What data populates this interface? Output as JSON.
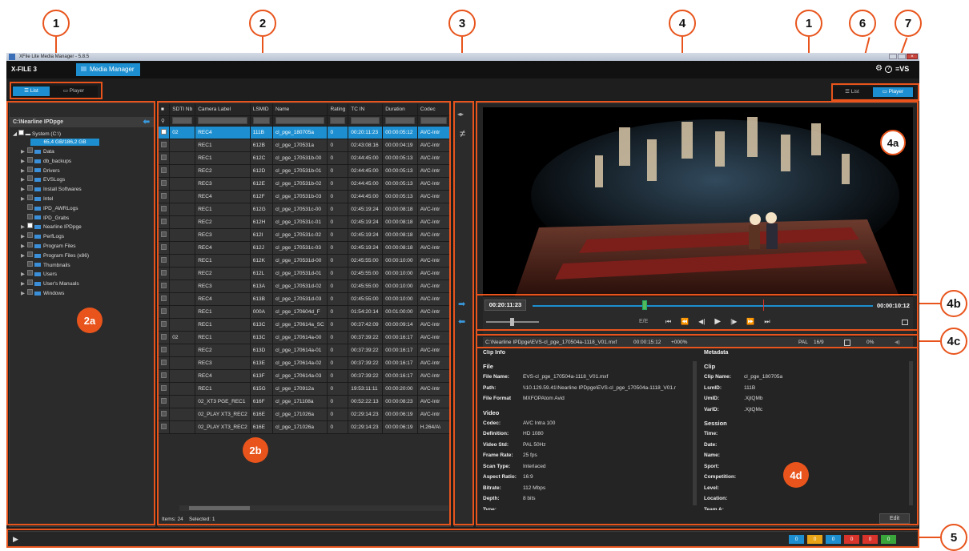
{
  "callouts": {
    "c1a": "1",
    "c2": "2",
    "c3": "3",
    "c4": "4",
    "c1b": "1",
    "c6": "6",
    "c7": "7",
    "c4a": "4a",
    "c2a": "2a",
    "c2b": "2b",
    "c4b": "4b",
    "c4c": "4c",
    "c4d": "4d",
    "c5": "5"
  },
  "window": {
    "title": "XFile Lite Media Manager - 5.8.5"
  },
  "app": {
    "brand": "X-FILE 3",
    "tab": "Media Manager",
    "evs": "≡VS",
    "gear": "⚙",
    "help": "?"
  },
  "view_left": {
    "list": "List",
    "player": "Player"
  },
  "view_right": {
    "list": "List",
    "player": "Player"
  },
  "tree": {
    "path": "C:\\Nearline IPDpge",
    "drive": "System (C:\\)",
    "usage": "65,4 GB/186,2 GB",
    "folders": [
      {
        "name": "Data",
        "arrow": "▶",
        "chk": false
      },
      {
        "name": "db_backups",
        "arrow": "▶",
        "chk": false
      },
      {
        "name": "Drivers",
        "arrow": "▶",
        "chk": false
      },
      {
        "name": "EVSLogs",
        "arrow": "▶",
        "chk": false
      },
      {
        "name": "Install Softwares",
        "arrow": "▶",
        "chk": false
      },
      {
        "name": "Intel",
        "arrow": "▶",
        "chk": false
      },
      {
        "name": "IPD_AWRLogs",
        "arrow": "",
        "chk": false
      },
      {
        "name": "IPD_Grabs",
        "arrow": "",
        "chk": false
      },
      {
        "name": "Nearline IPDpge",
        "arrow": "▶",
        "chk": true
      },
      {
        "name": "PerfLogs",
        "arrow": "▶",
        "chk": false
      },
      {
        "name": "Program Files",
        "arrow": "▶",
        "chk": false
      },
      {
        "name": "Program Files (x86)",
        "arrow": "▶",
        "chk": false
      },
      {
        "name": "Thumbnails",
        "arrow": "",
        "chk": false
      },
      {
        "name": "Users",
        "arrow": "▶",
        "chk": false
      },
      {
        "name": "User's Manuals",
        "arrow": "▶",
        "chk": false
      },
      {
        "name": "Windows",
        "arrow": "▶",
        "chk": false
      }
    ]
  },
  "table": {
    "headers": [
      "■",
      "SDTI Nb",
      "Camera Label",
      "LSMID",
      "Name",
      "Rating",
      "TC IN",
      "Duration",
      "Codec"
    ],
    "rows": [
      [
        "",
        "02",
        "REC4",
        "111B",
        "cl_pge_180705a",
        "0",
        "00:20:11:23",
        "00:00:05:12",
        "AVC-Intr"
      ],
      [
        "",
        "",
        "REC1",
        "612B",
        "cl_pge_170531a",
        "0",
        "02:43:08:16",
        "00:00:04:19",
        "AVC-Intr"
      ],
      [
        "",
        "",
        "REC1",
        "612C",
        "cl_pge_170531b-00",
        "0",
        "02:44:45:00",
        "00:00:05:13",
        "AVC-Intr"
      ],
      [
        "",
        "",
        "REC2",
        "612D",
        "cl_pge_170531b-01",
        "0",
        "02:44:45:00",
        "00:00:05:13",
        "AVC-Intr"
      ],
      [
        "",
        "",
        "REC3",
        "612E",
        "cl_pge_170531b-02",
        "0",
        "02:44:45:00",
        "00:00:05:13",
        "AVC-Intr"
      ],
      [
        "",
        "",
        "REC4",
        "612F",
        "cl_pge_170531b-03",
        "0",
        "02:44:45:00",
        "00:00:05:13",
        "AVC-Intr"
      ],
      [
        "",
        "",
        "REC1",
        "612G",
        "cl_pge_170531c-00",
        "0",
        "02:45:19:24",
        "00:00:08:18",
        "AVC-Intr"
      ],
      [
        "",
        "",
        "REC2",
        "612H",
        "cl_pge_170531c-01",
        "0",
        "02:45:19:24",
        "00:00:08:18",
        "AVC-Intr"
      ],
      [
        "",
        "",
        "REC3",
        "612I",
        "cl_pge_170531c-02",
        "0",
        "02:45:19:24",
        "00:00:08:18",
        "AVC-Intr"
      ],
      [
        "",
        "",
        "REC4",
        "612J",
        "cl_pge_170531c-03",
        "0",
        "02:45:19:24",
        "00:00:08:18",
        "AVC-Intr"
      ],
      [
        "",
        "",
        "REC1",
        "612K",
        "cl_pge_170531d-00",
        "0",
        "02:45:55:00",
        "00:00:10:00",
        "AVC-Intr"
      ],
      [
        "",
        "",
        "REC2",
        "612L",
        "cl_pge_170531d-01",
        "0",
        "02:45:55:00",
        "00:00:10:00",
        "AVC-Intr"
      ],
      [
        "",
        "",
        "REC3",
        "613A",
        "cl_pge_170531d-02",
        "0",
        "02:45:55:00",
        "00:00:10:00",
        "AVC-Intr"
      ],
      [
        "",
        "",
        "REC4",
        "613B",
        "cl_pge_170531d-03",
        "0",
        "02:45:55:00",
        "00:00:10:00",
        "AVC-Intr"
      ],
      [
        "",
        "",
        "REC1",
        "000A",
        "cl_pge_170604d_F",
        "0",
        "01:54:20:14",
        "00:01:00:00",
        "AVC-Intr"
      ],
      [
        "",
        "",
        "REC1",
        "613C",
        "cl_pge_170614a_SC",
        "0",
        "00:37:42:09",
        "00:00:09:14",
        "AVC-Intr"
      ],
      [
        "",
        "02",
        "REC1",
        "613C",
        "cl_pge_170614a-00",
        "0",
        "00:37:39:22",
        "00:00:16:17",
        "AVC-Intr"
      ],
      [
        "",
        "",
        "REC2",
        "613D",
        "cl_pge_170614a-01",
        "0",
        "00:37:39:22",
        "00:00:16:17",
        "AVC-Intr"
      ],
      [
        "",
        "",
        "REC3",
        "613E",
        "cl_pge_170614a-02",
        "0",
        "00:37:39:22",
        "00:00:16:17",
        "AVC-Intr"
      ],
      [
        "",
        "",
        "REC4",
        "613F",
        "cl_pge_170614a-03",
        "0",
        "00:37:39:22",
        "00:00:16:17",
        "AVC-Intr"
      ],
      [
        "",
        "",
        "REC1",
        "615G",
        "cl_pge_170912a",
        "0",
        "19:53:11:11",
        "00:00:20:00",
        "AVC-Intr"
      ],
      [
        "",
        "",
        "02_XT3 PGE_REC1",
        "616F",
        "cl_pge_171108a",
        "0",
        "00:52:22:13",
        "00:00:08:23",
        "AVC-Intr"
      ],
      [
        "",
        "",
        "02_PLAY XT3_REC2",
        "616E",
        "cl_pge_171026a",
        "0",
        "02:29:14:23",
        "00:00:06:19",
        "AVC-Intr"
      ],
      [
        "",
        "",
        "02_PLAY XT3_REC2",
        "616E",
        "cl_pge_171026a",
        "0",
        "02:29:14:23",
        "00:00:06:19",
        "H.264/A\\"
      ]
    ],
    "footer_items": "Items: 24",
    "footer_selected": "Selected: 1"
  },
  "player": {
    "tc_in": "00:20:11:23",
    "tc_dur": "00:00:10:12",
    "ee": "E/E",
    "position": 0.33,
    "info_path": "C:\\Nearline IPDpge\\EVS-cl_pge_170504a-1118_V01.mxf",
    "info_dur": "00:00:15:12",
    "info_speed": "+000%",
    "info_std": "PAL",
    "info_ratio": "16/9",
    "info_pct": "0%"
  },
  "clipinfo": {
    "title": "Clip Info",
    "file_h": "File",
    "file": [
      [
        "File Name:",
        "EVS-cl_pge_170504a-1118_V01.mxf"
      ],
      [
        "Path:",
        "\\\\10.129.59.41\\Nearline IPDpge\\EVS-cl_pge_170504a-1118_V01.r"
      ],
      [
        "File Format",
        "MXFOPAtom Avid"
      ]
    ],
    "video_h": "Video",
    "video": [
      [
        "Codec:",
        "AVC Intra 100"
      ],
      [
        "Definition:",
        "HD 1080"
      ],
      [
        "Video Std:",
        "PAL 50Hz"
      ],
      [
        "Frame Rate:",
        "25 fps"
      ],
      [
        "Scan Type:",
        "Interlaced"
      ],
      [
        "Aspect Ratio:",
        "16:9"
      ],
      [
        "Bitrate:",
        "112 Mbps"
      ],
      [
        "Depth:",
        "8 bits"
      ],
      [
        "Type:",
        ""
      ]
    ]
  },
  "metadata": {
    "title": "Metadata",
    "clip_h": "Clip",
    "clip": [
      [
        "Clip Name:",
        "cl_pge_180705a"
      ],
      [
        "LsmID:",
        "111B"
      ],
      [
        "UmID:",
        ".XjtQMb"
      ],
      [
        "VarID:",
        ".XjtQMc"
      ]
    ],
    "session_h": "Session",
    "session": [
      [
        "Time:",
        ""
      ],
      [
        "Date:",
        ""
      ],
      [
        "Name:",
        ""
      ],
      [
        "Sport:",
        ""
      ],
      [
        "Competition:",
        ""
      ],
      [
        "Level:",
        ""
      ],
      [
        "Location:",
        ""
      ],
      [
        "Team A:",
        ""
      ]
    ],
    "edit": "Edit"
  },
  "status": {
    "badges": [
      "0",
      "0",
      "0",
      "0",
      "0",
      "0"
    ],
    "colors": [
      "#1d8fd0",
      "#e8a317",
      "#1d8fd0",
      "#d9342b",
      "#d9342b",
      "#3aa53a"
    ]
  }
}
